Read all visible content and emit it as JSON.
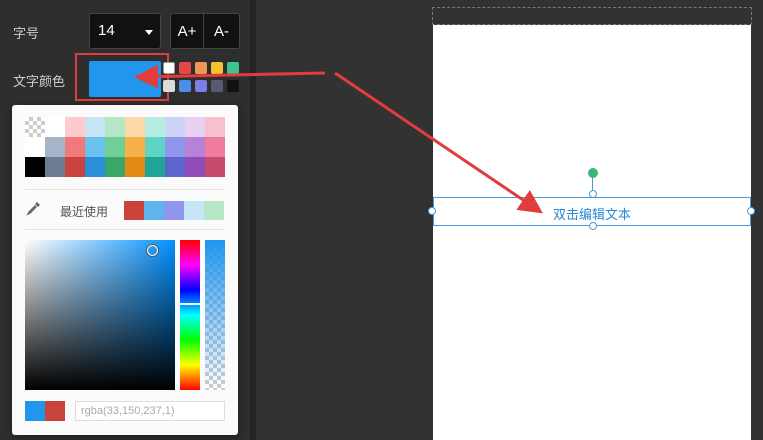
{
  "text_panel": {
    "font_size_label": "字号",
    "font_size_value": "14",
    "increase_label": "A+",
    "decrease_label": "A-",
    "text_color_label": "文字颜色",
    "current_color": "#2196ed",
    "quick_colors": [
      "#ffffff",
      "#e24a4a",
      "#f0955a",
      "#f5c12e",
      "#3cc492",
      "#dcdcdc",
      "#4a8ee6",
      "#7a7ee6",
      "#555c70",
      "#111111"
    ]
  },
  "color_picker": {
    "palette": [
      [
        "transparent",
        "#ffffff",
        "#ffc9d0",
        "#c6e6f5",
        "#b5e6c6",
        "#fcd9a6",
        "#b5ece4",
        "#cfd3f7",
        "#e6d2f0",
        "#f8bfcf"
      ],
      [
        "#ffffff",
        "#a7b4c8",
        "#f07a7a",
        "#6cc1ee",
        "#6fcf97",
        "#f5b24a",
        "#5fd3c4",
        "#8f96ec",
        "#b682d8",
        "#ef7c9c"
      ],
      [
        "#000000",
        "#6b7c93",
        "#c9423b",
        "#2a8fd6",
        "#3aa668",
        "#e38a12",
        "#1ea597",
        "#5d64cc",
        "#8f4cb8",
        "#c44b6c"
      ]
    ],
    "eyedropper_icon": "eyedropper-icon",
    "recent_label": "最近使用",
    "recent_colors": [
      "#c9423b",
      "#5fb4ee",
      "#8f96ec",
      "#c6e6f5",
      "#b5e6c6"
    ],
    "current_preview": "#2196ed",
    "previous_preview": "#c9423b",
    "rgba_value": "rgba(33,150,237,1)"
  },
  "canvas": {
    "text_element": "双击编辑文本"
  }
}
